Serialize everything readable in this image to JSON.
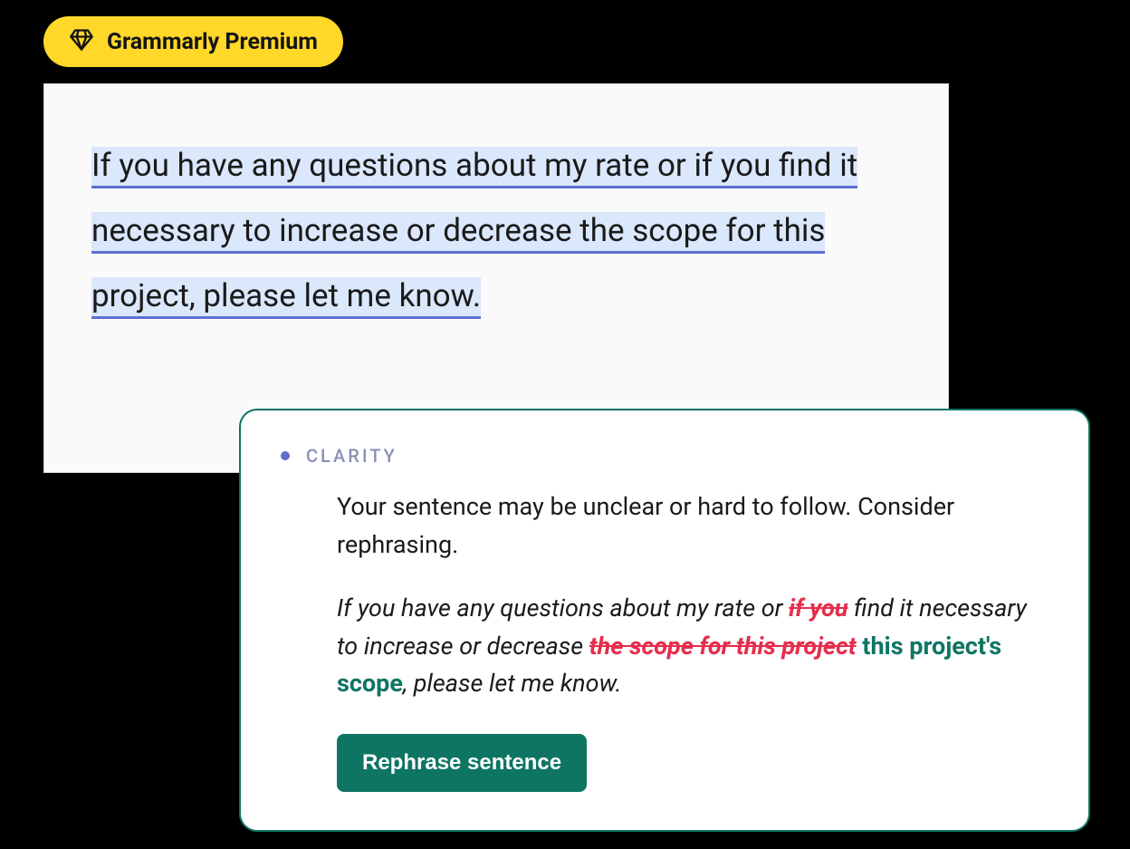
{
  "badge": {
    "label": "Grammarly Premium"
  },
  "editor": {
    "sentence": "If you have any questions about my rate or if you find it necessary to increase or decrease the scope for this project, please let me know."
  },
  "suggestion": {
    "category": "CLARITY",
    "explanation": "Your sentence may be unclear or hard to follow. Consider rephrasing.",
    "rewrite": {
      "part1": "If you have any questions about my rate or ",
      "strike1": "if you",
      "part2": " find it necessary to increase or decrease ",
      "strike2": "the scope for this project",
      "replacement": " this project's scope",
      "part3": ", please let me know."
    },
    "button": "Rephrase sentence"
  }
}
